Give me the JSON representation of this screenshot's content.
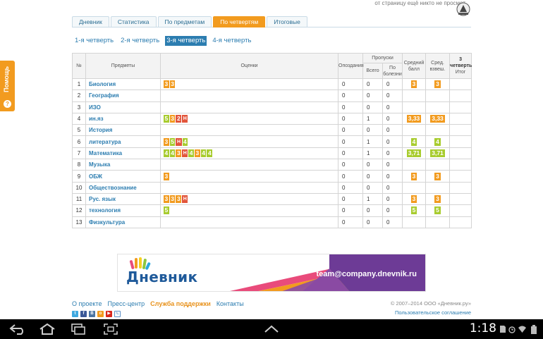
{
  "page": {
    "top_note": "от страницу ещё никто не просмот",
    "help_label": "Помощь",
    "help_icon": "?"
  },
  "tabs": [
    {
      "label": "Дневник",
      "active": false
    },
    {
      "label": "Статистика",
      "active": false
    },
    {
      "label": "По предметам",
      "active": false
    },
    {
      "label": "По четвертям",
      "active": true
    },
    {
      "label": "Итоговые",
      "active": false
    }
  ],
  "quarters": [
    {
      "label": "1-я четверть",
      "active": false
    },
    {
      "label": "2-я четверть",
      "active": false
    },
    {
      "label": "3-я четверть",
      "active": true
    },
    {
      "label": "4-я четверть",
      "active": false
    }
  ],
  "table": {
    "headers": {
      "num": "№",
      "subject": "Предметы",
      "grades": "Оценки",
      "late": "Опоздания",
      "absences": "Пропуски",
      "total": "Всего",
      "sick": "По болезни",
      "avg": "Средний балл",
      "weighted": "Сред. взвеш.",
      "final_top": "3 четверть",
      "final_bottom": "Итог"
    },
    "rows": [
      {
        "n": "1",
        "subject": "Биология",
        "marks": [
          "3",
          "3"
        ],
        "late": "0",
        "total": "0",
        "sick": "0",
        "avg": "3",
        "weighted": "3"
      },
      {
        "n": "2",
        "subject": "География",
        "marks": [],
        "late": "0",
        "total": "0",
        "sick": "0",
        "avg": "",
        "weighted": ""
      },
      {
        "n": "3",
        "subject": "ИЗО",
        "marks": [],
        "late": "0",
        "total": "0",
        "sick": "0",
        "avg": "",
        "weighted": ""
      },
      {
        "n": "4",
        "subject": "ин.яз",
        "marks": [
          "5",
          "3",
          "2",
          "Н"
        ],
        "late": "0",
        "total": "1",
        "sick": "0",
        "avg": "3,33",
        "weighted": "3,33"
      },
      {
        "n": "5",
        "subject": "История",
        "marks": [],
        "late": "0",
        "total": "0",
        "sick": "0",
        "avg": "",
        "weighted": ""
      },
      {
        "n": "6",
        "subject": "литература",
        "marks": [
          "3",
          "5",
          "Н",
          "4"
        ],
        "late": "0",
        "total": "1",
        "sick": "0",
        "avg": "4",
        "weighted": "4"
      },
      {
        "n": "7",
        "subject": "Математика",
        "marks": [
          "4",
          "4",
          "3",
          "Н",
          "4",
          "3",
          "4",
          "4"
        ],
        "late": "0",
        "total": "1",
        "sick": "0",
        "avg": "3,71",
        "weighted": "3,71"
      },
      {
        "n": "8",
        "subject": "Музыка",
        "marks": [],
        "late": "0",
        "total": "0",
        "sick": "0",
        "avg": "",
        "weighted": ""
      },
      {
        "n": "9",
        "subject": "ОБЖ",
        "marks": [
          "3"
        ],
        "late": "0",
        "total": "0",
        "sick": "0",
        "avg": "3",
        "weighted": "3"
      },
      {
        "n": "10",
        "subject": "Обществознание",
        "marks": [],
        "late": "0",
        "total": "0",
        "sick": "0",
        "avg": "",
        "weighted": ""
      },
      {
        "n": "11",
        "subject": "Рус. язык",
        "marks": [
          "3",
          "3",
          "3",
          "Н"
        ],
        "late": "0",
        "total": "1",
        "sick": "0",
        "avg": "3",
        "weighted": "3"
      },
      {
        "n": "12",
        "subject": "технология",
        "marks": [
          "5"
        ],
        "late": "0",
        "total": "0",
        "sick": "0",
        "avg": "5",
        "weighted": "5"
      },
      {
        "n": "13",
        "subject": "Физкультура",
        "marks": [],
        "late": "0",
        "total": "0",
        "sick": "0",
        "avg": "",
        "weighted": ""
      }
    ]
  },
  "colors": {
    "mark_5": "#a8cc2f",
    "mark_4": "#a8cc2f",
    "mark_3": "#f29b1f",
    "mark_2": "#e2553b",
    "mark_absent": "#e2553b",
    "accent": "#2c7db0",
    "tab_active": "#f29b1f"
  },
  "banner": {
    "brand": "Дневник",
    "email": "team@company.dnevnik.ru"
  },
  "footer": {
    "links": [
      "О проекте",
      "Пресс-центр",
      "Служба поддержки",
      "Контакты"
    ],
    "copyright": "© 2007–2014 ООО «Дневник.ру»",
    "agreement": "Пользовательское соглашение",
    "social_icons": [
      "twitter-icon",
      "facebook-icon",
      "vk-icon",
      "odnoklassniki-icon",
      "youtube-icon",
      "livejournal-icon"
    ]
  },
  "system_bar": {
    "time": "1:18",
    "icons": [
      "back-icon",
      "home-icon",
      "recent-apps-icon",
      "screenshot-icon",
      "expand-icon",
      "sd-icon",
      "alarm-icon",
      "wifi-icon",
      "battery-icon"
    ]
  }
}
